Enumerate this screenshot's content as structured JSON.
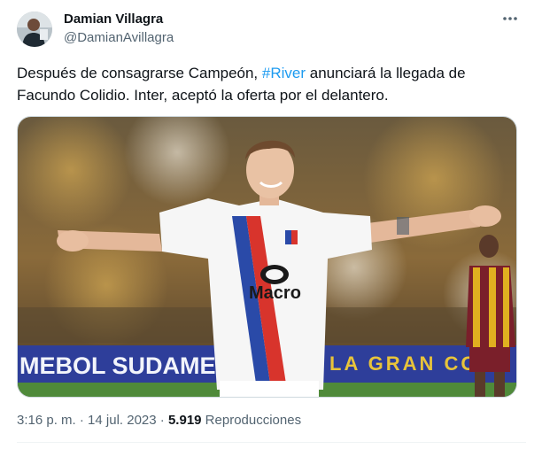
{
  "author": {
    "name": "Damian Villagra",
    "handle": "@DamianAvillagra"
  },
  "tweet": {
    "text_part1": "Después de consagrarse Campeón, ",
    "hashtag": "#River",
    "text_part2": " anunciará la llegada de Facundo Colidio. Inter, aceptó la oferta por el delantero."
  },
  "media": {
    "description_icon": "photo",
    "jersey_sponsor": "Macro",
    "banner_left": "MEBOL SUDAMER",
    "banner_right": "LA GRAN CO"
  },
  "meta": {
    "time": "3:16 p. m.",
    "separator": " · ",
    "date": "14 jul. 2023",
    "views_count": "5.919",
    "views_label": " Reproducciones"
  },
  "colors": {
    "link": "#1d9bf0",
    "secondary_text": "#536471",
    "primary_text": "#0f1419"
  }
}
